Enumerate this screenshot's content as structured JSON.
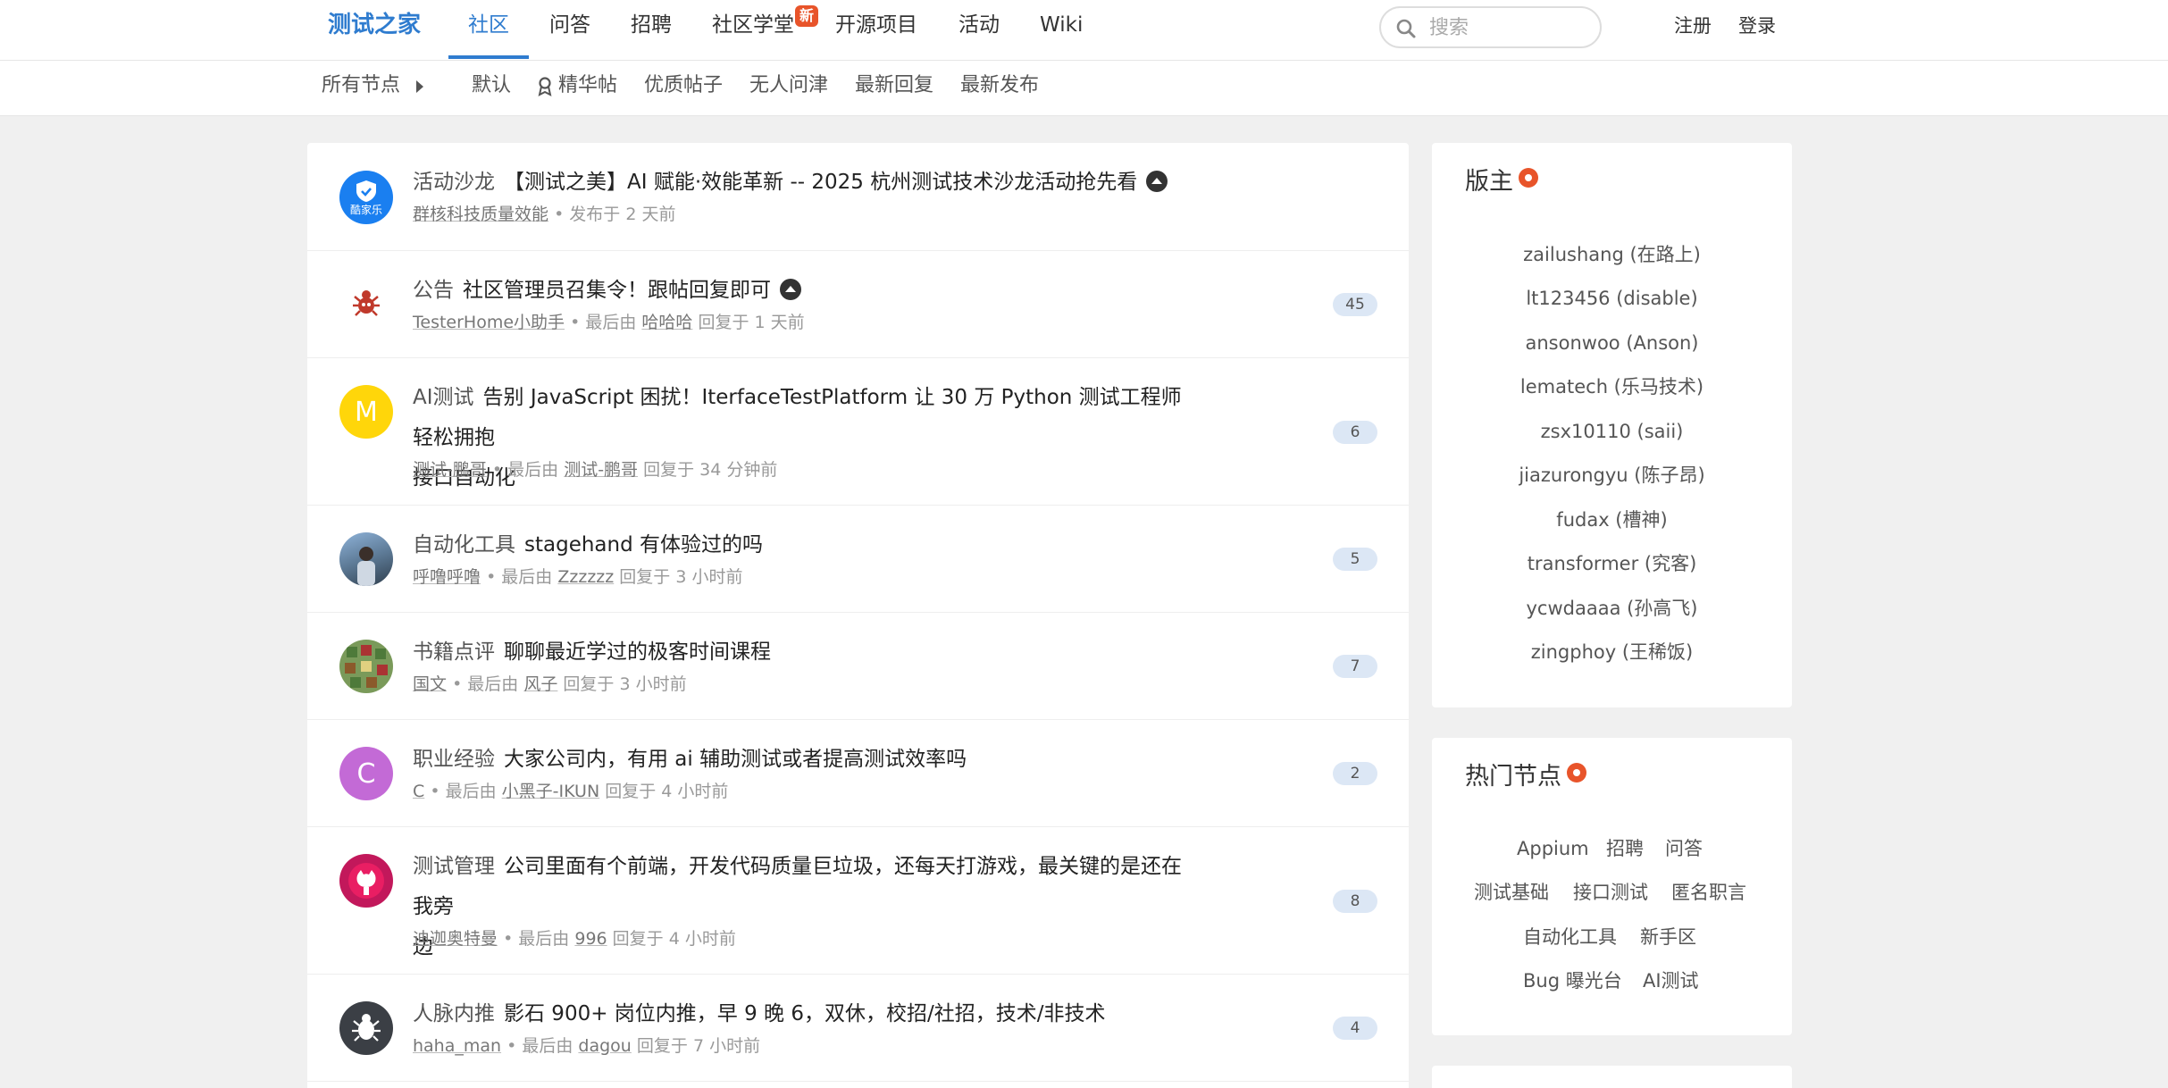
{
  "header": {
    "brand": "测试之家",
    "nav": [
      "社区",
      "问答",
      "招聘",
      "社区学堂",
      "开源项目",
      "活动",
      "Wiki"
    ],
    "new_badge": "新",
    "search_placeholder": "搜索",
    "register": "注册",
    "login": "登录"
  },
  "subnav": {
    "all_nodes": "所有节点",
    "filters": [
      "默认",
      "精华帖",
      "优质帖子",
      "无人问津",
      "最新回复",
      "最新发布"
    ]
  },
  "topics": [
    {
      "node": "活动沙龙",
      "title": "【测试之美】AI 赋能·效能革新 -- 2025 杭州测试技术沙龙活动抢先看",
      "author": "群核科技质量效能",
      "meta_rest": "• 发布于 2 天前",
      "avatar_text": "酷家乐",
      "avatar_color": "#1a7ff0"
    },
    {
      "node": "公告",
      "title": "社区管理员召集令！跟帖回复即可",
      "author": "TesterHome小助手",
      "last_prefix": "• 最后由",
      "last_user": "哈哈哈",
      "reply_time": "回复于 1 天前",
      "count": "45",
      "avatar_color": "#c0392b"
    },
    {
      "node": "AI测试",
      "title": "告别 JavaScript 困扰！IterfaceTestPlatform 让 30 万 Python 测试工程师轻松拥抱",
      "title2": "接口自动化",
      "author": "测试-鹏哥",
      "last_prefix": "• 最后由",
      "last_user": "测试-鹏哥",
      "reply_time": "回复于 34 分钟前",
      "count": "6",
      "avatar_text": "M",
      "avatar_color": "#ffd60a"
    },
    {
      "node": "自动化工具",
      "title": "stagehand 有体验过的吗",
      "author": "呼噜呼噜",
      "last_prefix": "• 最后由",
      "last_user": "Zzzzzz",
      "reply_time": "回复于 3 小时前",
      "count": "5",
      "avatar_color": "#5d7a96"
    },
    {
      "node": "书籍点评",
      "title": "聊聊最近学过的极客时间课程",
      "author": "国文",
      "last_prefix": "• 最后由",
      "last_user": "风子",
      "reply_time": "回复于 3 小时前",
      "count": "7",
      "avatar_color": "#5f8f4a"
    },
    {
      "node": "职业经验",
      "title": "大家公司内，有用 ai 辅助测试或者提高测试效率吗",
      "author": "C",
      "last_prefix": "• 最后由",
      "last_user": "小黑子-IKUN",
      "reply_time": "回复于 4 小时前",
      "count": "2",
      "avatar_text": "C",
      "avatar_color": "#c36ad6"
    },
    {
      "node": "测试管理",
      "title": "公司里面有个前端，开发代码质量巨垃圾，还每天打游戏，最关键的是还在我旁",
      "title2": "边",
      "author": "迪迦奥特曼",
      "last_prefix": "• 最后由",
      "last_user": "996",
      "reply_time": "回复于 4 小时前",
      "count": "8",
      "avatar_color": "#c2185b"
    },
    {
      "node": "人脉内推",
      "title": "影石 900+ 岗位内推，早 9 晚 6，双休，校招/社招，技术/非技术",
      "author": "haha_man",
      "last_prefix": "• 最后由",
      "last_user": "dagou",
      "reply_time": "回复于 7 小时前",
      "count": "4",
      "avatar_color": "#3b3f45"
    }
  ],
  "sidebar": {
    "moderators_title": "版主",
    "moderators": [
      "zailushang (在路上)",
      "lt123456 (disable)",
      "ansonwoo (Anson)",
      "lematech (乐马技术)",
      "zsx10110 (saii)",
      "jiazurongyu (陈子昂)",
      "fudax (槽神)",
      "transformer (究客)",
      "ycwdaaaa (孙高飞)",
      "zingphoy (王稀饭)"
    ],
    "hot_nodes_title": "热门节点",
    "hot_nodes": [
      "Appium",
      "招聘",
      "问答",
      "测试基础",
      "接口测试",
      "匿名职言",
      "自动化工具",
      "新手区",
      "Bug 曝光台",
      "AI测试"
    ]
  }
}
